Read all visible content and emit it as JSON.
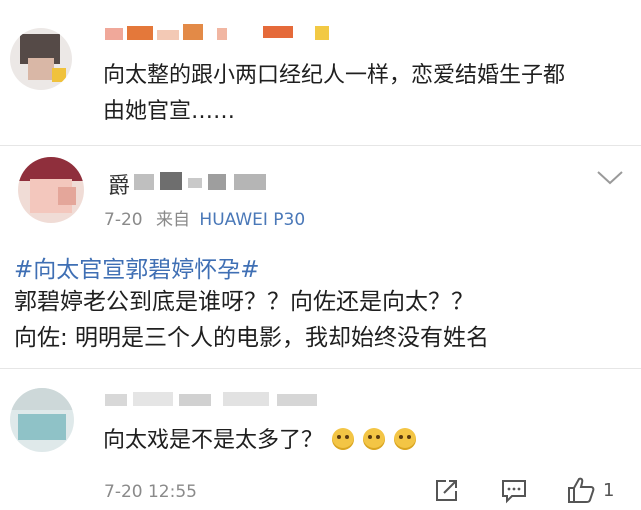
{
  "comment1": {
    "text_line1": "向太整的跟小两口经纪人一样，恋爱结婚生子都",
    "text_line2": "由她官宣……"
  },
  "post": {
    "name_visible": "爵",
    "time": "7-20",
    "source_prefix": "来自",
    "source_device": "HUAWEI P30",
    "hashtag": "#向太官宣郭碧婷怀孕#",
    "line1": "郭碧婷老公到底是谁呀？？向佐还是向太？？",
    "line2": "向佐: 明明是三个人的电影，我却始终没有姓名"
  },
  "comment2": {
    "text": "向太戏是不是太多了？",
    "emoji_count": 3,
    "time": "7-20 12:55",
    "like_count": "1"
  },
  "icons": {
    "chevron": "chevron-down-icon",
    "share": "share-icon",
    "comment": "comment-icon",
    "like": "thumbs-up-icon"
  }
}
